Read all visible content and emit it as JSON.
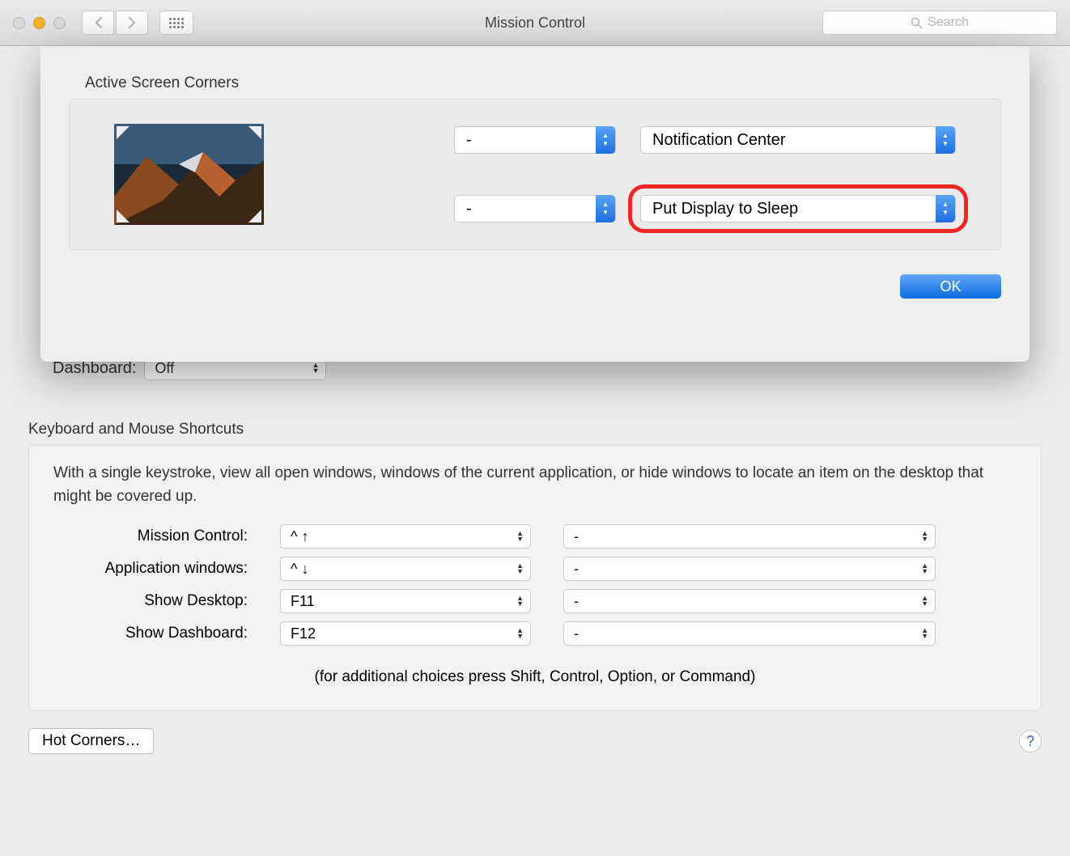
{
  "window": {
    "title": "Mission Control",
    "search_placeholder": "Search"
  },
  "sheet": {
    "title": "Active Screen Corners",
    "corners": {
      "tl": "-",
      "bl": "-",
      "tr": "Notification Center",
      "br": "Put Display to Sleep"
    },
    "ok": "OK"
  },
  "dashboard": {
    "label": "Dashboard:",
    "value": "Off"
  },
  "kbm": {
    "title": "Keyboard and Mouse Shortcuts",
    "description": "With a single keystroke, view all open windows, windows of the current application, or hide windows to locate an item on the desktop that might be covered up.",
    "rows": [
      {
        "label": "Mission Control:",
        "kb": "^ ↑",
        "mouse": "-"
      },
      {
        "label": "Application windows:",
        "kb": "^ ↓",
        "mouse": "-"
      },
      {
        "label": "Show Desktop:",
        "kb": "F11",
        "mouse": "-"
      },
      {
        "label": "Show Dashboard:",
        "kb": "F12",
        "mouse": "-"
      }
    ],
    "footer": "(for additional choices press Shift, Control, Option, or Command)"
  },
  "bottom": {
    "hot_corners": "Hot Corners…",
    "help": "?"
  }
}
